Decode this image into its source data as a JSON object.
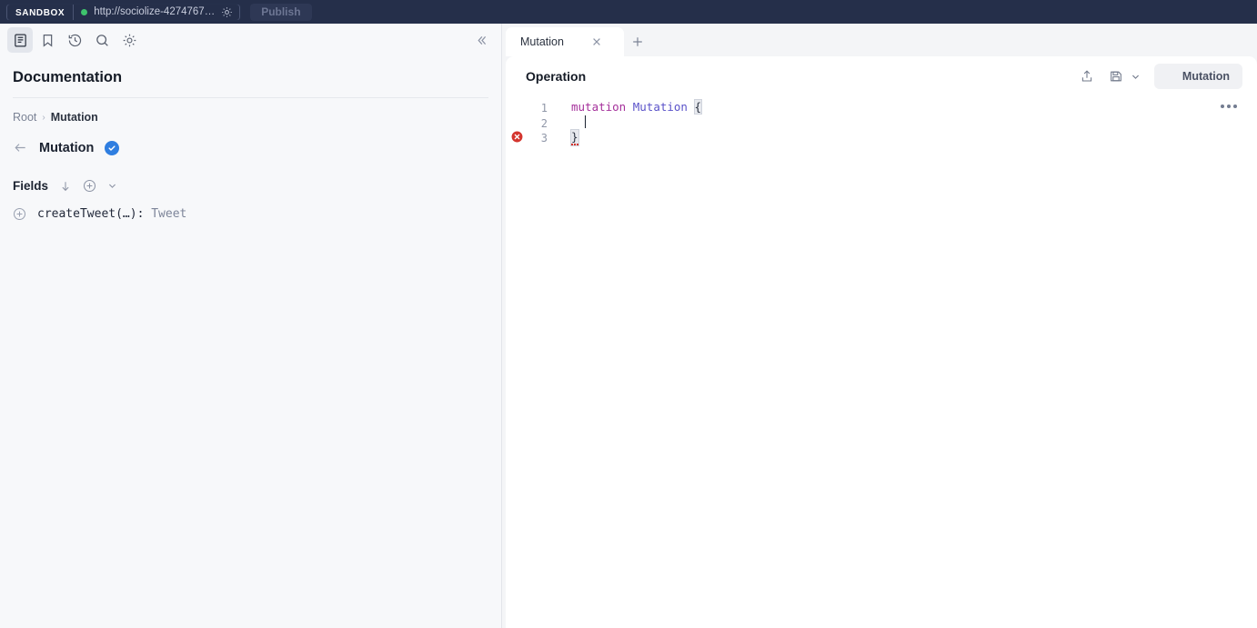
{
  "topbar": {
    "badge": "SANDBOX",
    "url": "http://sociolize-4274767…",
    "settings_icon": "gear-icon",
    "publish_label": "Publish",
    "status_dot_color": "#3ec46d",
    "background_color": "#252f4a"
  },
  "sidebar": {
    "tools": [
      {
        "name": "documentation-icon",
        "label": "Documentation",
        "active": true
      },
      {
        "name": "bookmark-icon",
        "label": "Saved operations",
        "active": false
      },
      {
        "name": "history-icon",
        "label": "History",
        "active": false
      },
      {
        "name": "search-icon",
        "label": "Search",
        "active": false
      },
      {
        "name": "settings-icon",
        "label": "Settings",
        "active": false
      }
    ],
    "collapse_icon": "chevrons-left-icon",
    "title": "Documentation",
    "breadcrumb": {
      "root": "Root",
      "separator": "›",
      "current": "Mutation"
    },
    "type_header": {
      "back_icon": "arrow-left-icon",
      "name": "Mutation",
      "badge_icon": "check-circle-icon",
      "badge_color": "#2f7ee0"
    },
    "fields": {
      "label": "Fields",
      "sort_icon": "arrow-down-icon",
      "add_icon": "plus-circle-icon",
      "chevron_icon": "chevron-down-icon",
      "items": [
        {
          "add_icon": "plus-circle-icon",
          "name": "createTweet(…):",
          "type": " Tweet"
        }
      ]
    }
  },
  "tabs": {
    "items": [
      {
        "label": "Mutation",
        "close_icon": "close-icon",
        "active": true
      }
    ],
    "add_icon": "plus-icon"
  },
  "operation": {
    "title": "Operation",
    "actions": {
      "share_icon": "share-icon",
      "save_icon": "save-icon",
      "save_chevron_icon": "chevron-down-icon",
      "run_icon": "play-icon",
      "run_label": "Mutation"
    },
    "more_icon": "more-horizontal-icon",
    "editor": {
      "lines": [
        {
          "number": "1",
          "keyword": "mutation",
          "name": "Mutation",
          "brace": "{",
          "error": false
        },
        {
          "number": "2",
          "keyword": "",
          "name": "",
          "brace": "",
          "error": false
        },
        {
          "number": "3",
          "keyword": "",
          "name": "",
          "brace": "}",
          "error": true
        }
      ],
      "error_marker_icon": "error-circle-icon",
      "error_color": "#d4352e"
    }
  }
}
